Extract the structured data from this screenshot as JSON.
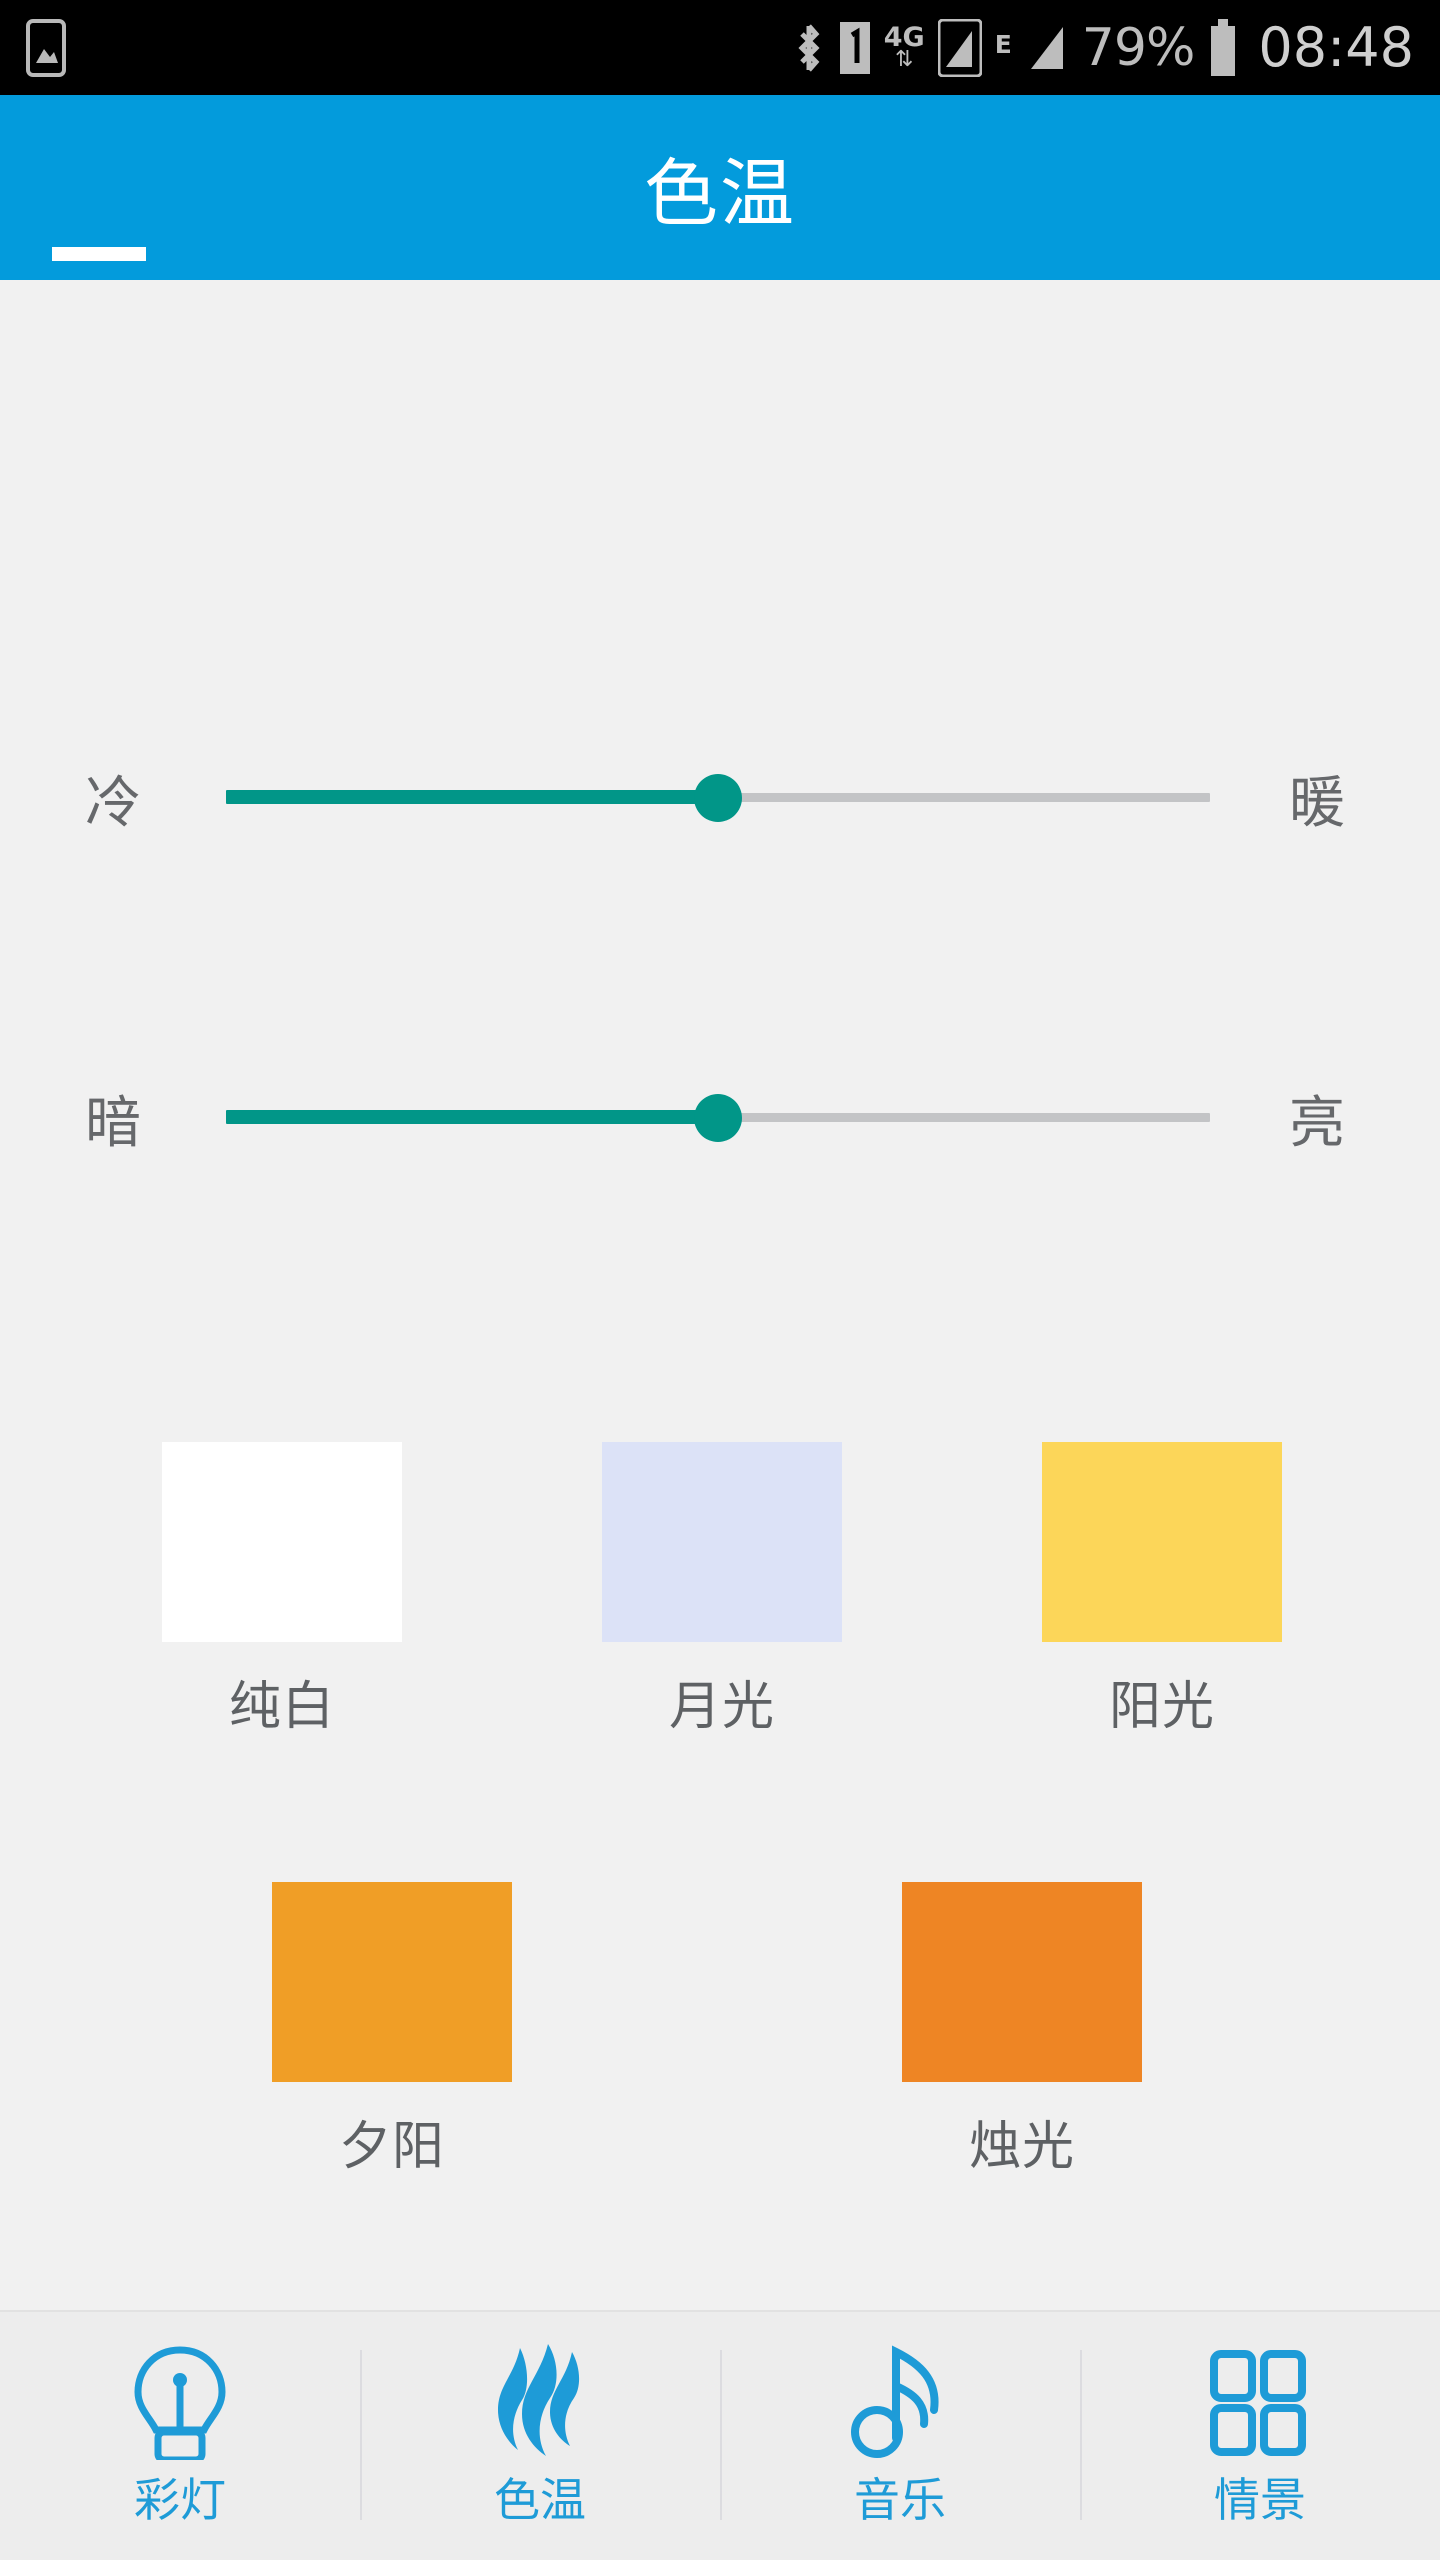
{
  "statusbar": {
    "left_icons": [
      {
        "name": "gallery-image-icon",
        "glyph": "image"
      }
    ],
    "right_icons": [
      {
        "name": "bluetooth-icon",
        "glyph": "bluetooth"
      },
      {
        "name": "sim-1-icon",
        "glyph": "1"
      },
      {
        "name": "mobile-data-4g-icon",
        "label": "4G",
        "arrows": "⇅"
      },
      {
        "name": "signal-bars-sim1-icon",
        "bars": 3
      },
      {
        "name": "edge-network-icon",
        "label": "E"
      },
      {
        "name": "signal-bars-sim2-icon",
        "bars": 3
      }
    ],
    "battery_percent": "79%",
    "battery_icon": "battery-icon",
    "clock": "08:48"
  },
  "appbar": {
    "menu_icon": "hamburger-menu-icon",
    "title": "色温",
    "background_color": "#039BDC",
    "title_color": "#FFFFFF"
  },
  "sliders": [
    {
      "id": "color-temperature",
      "left_label": "冷",
      "right_label": "暖",
      "value_percent": 50,
      "fill_color": "#019688",
      "track_color": "#C3C4C6"
    },
    {
      "id": "brightness",
      "left_label": "暗",
      "right_label": "亮",
      "value_percent": 50,
      "fill_color": "#019688",
      "track_color": "#C3C4C6"
    }
  ],
  "presets": {
    "row1": [
      {
        "label": "纯白",
        "color": "#FFFFFF"
      },
      {
        "label": "月光",
        "color": "#DCE2F7"
      },
      {
        "label": "阳光",
        "color": "#FCD659"
      }
    ],
    "row2": [
      {
        "label": "夕阳",
        "color": "#F09E26"
      },
      {
        "label": "烛光",
        "color": "#EE8524"
      }
    ]
  },
  "bottomnav": {
    "accent_color": "#1E9BD7",
    "items": [
      {
        "label": "彩灯",
        "icon": "lightbulb-icon",
        "active": false
      },
      {
        "label": "色温",
        "icon": "flame-icon",
        "active": true
      },
      {
        "label": "音乐",
        "icon": "music-note-icon",
        "active": false
      },
      {
        "label": "情景",
        "icon": "grid-squares-icon",
        "active": false
      }
    ]
  }
}
